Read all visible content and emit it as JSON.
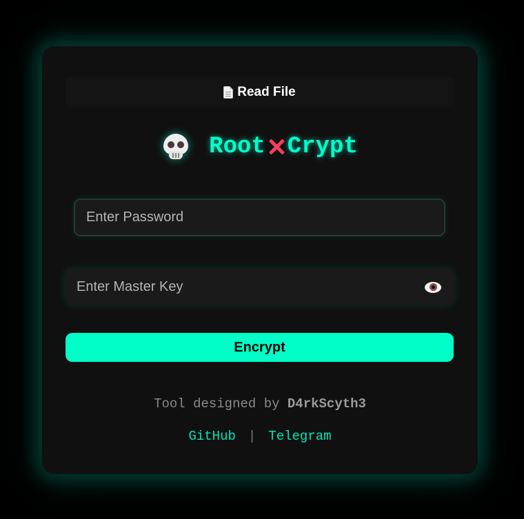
{
  "read_file": {
    "label": "Read File",
    "icon": "document-icon"
  },
  "brand": {
    "icon": "skull-icon",
    "part1": "Root",
    "separator_icon": "cross-mark-icon",
    "part2": "Crypt",
    "accent_color": "#00ffcc",
    "cross_color": "#f43f5e"
  },
  "form": {
    "password_placeholder": "Enter Password",
    "master_key_placeholder": "Enter Master Key",
    "visibility_icon": "eye-icon",
    "encrypt_label": "Encrypt",
    "button_color": "#00ffc8"
  },
  "footer": {
    "credit_prefix": "Tool designed by",
    "credit_name": "D4rkScyth3",
    "links": [
      "GitHub",
      "Telegram"
    ],
    "separator": "|"
  }
}
